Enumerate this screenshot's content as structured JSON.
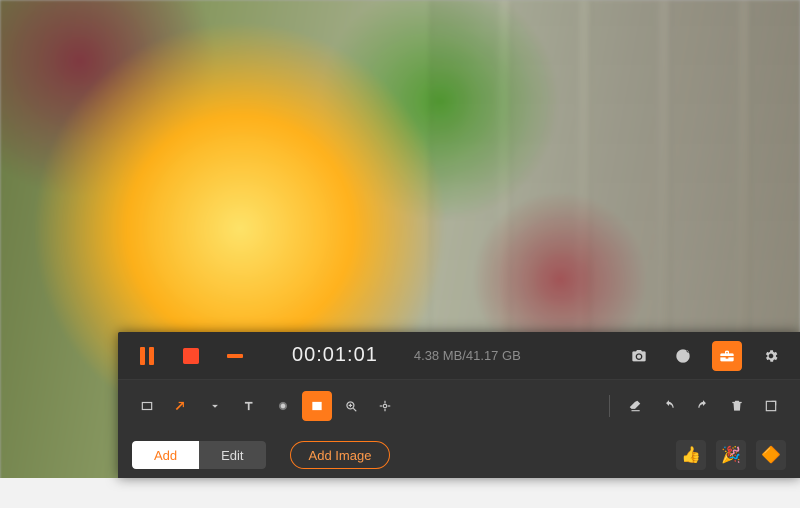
{
  "recording": {
    "timer": "00:01:01",
    "size_text": "4.38 MB/41.17 GB"
  },
  "tabs": {
    "add": "Add",
    "edit": "Edit"
  },
  "buttons": {
    "add_image": "Add Image"
  },
  "stickers": [
    "👍",
    "🎉",
    "🔶"
  ],
  "colors": {
    "accent": "#ff7a1a"
  }
}
